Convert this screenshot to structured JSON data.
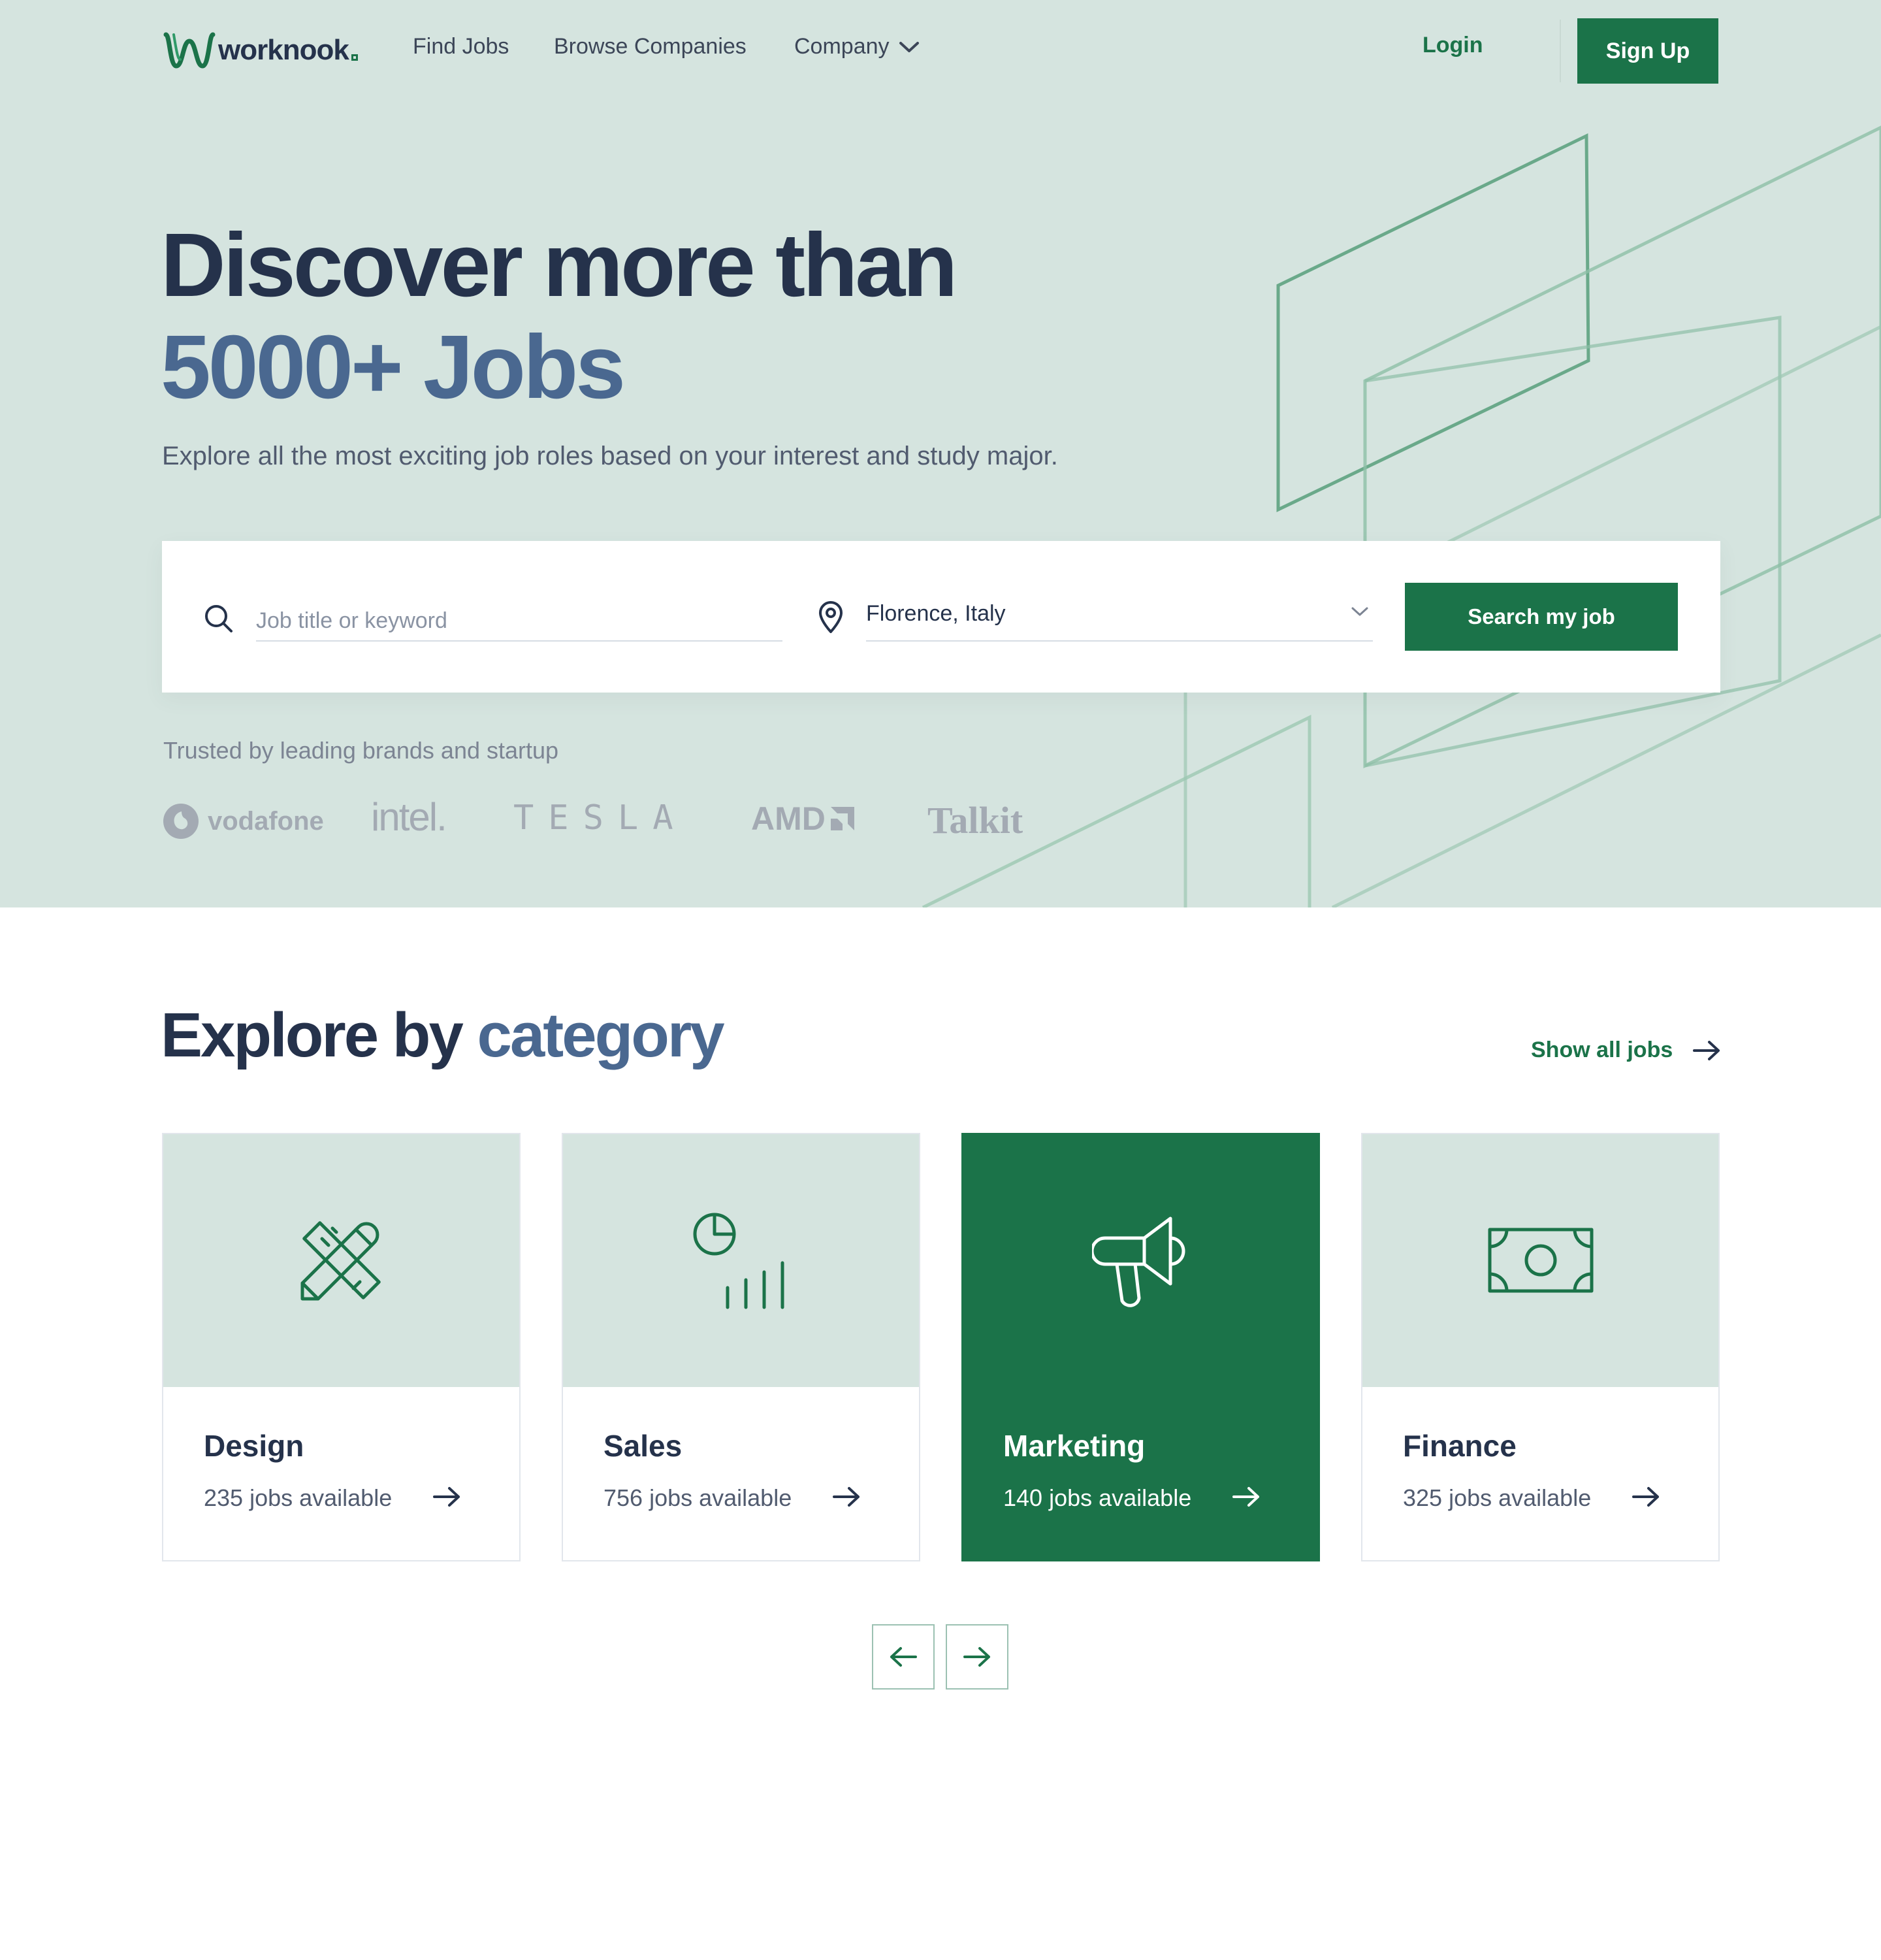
{
  "nav": {
    "logo_text": "worknook",
    "links": [
      "Find Jobs",
      "Browse Companies",
      "Company"
    ],
    "login_label": "Login",
    "signup_label": "Sign Up"
  },
  "hero": {
    "headline_line1": "Discover more than",
    "headline_line2": "5000+ Jobs",
    "subtitle": "Explore all the most exciting job roles based on your interest and study major."
  },
  "search": {
    "keyword_placeholder": "Job title or keyword",
    "keyword_value": "",
    "location_value": "Florence, Italy",
    "button_label": "Search my job"
  },
  "trusted": {
    "label": "Trusted by leading brands and startup",
    "brands": [
      "vodafone",
      "intel.",
      "TESLA",
      "AMD",
      "Talkit"
    ]
  },
  "categories": {
    "title_part1": "Explore by",
    "title_part2": "category",
    "show_all_label": "Show all jobs",
    "items": [
      {
        "name": "Design",
        "count": "235 jobs available",
        "icon": "design-tools-icon"
      },
      {
        "name": "Sales",
        "count": "756 jobs available",
        "icon": "sales-chart-icon"
      },
      {
        "name": "Marketing",
        "count": "140 jobs available",
        "icon": "megaphone-icon"
      },
      {
        "name": "Finance",
        "count": "325 jobs available",
        "icon": "banknote-icon"
      }
    ],
    "active_index": 2
  },
  "colors": {
    "brand_green": "#1B7349",
    "hero_bg": "#d5e4df",
    "heading_dark": "#25324B",
    "heading_accent": "#4a6890"
  }
}
